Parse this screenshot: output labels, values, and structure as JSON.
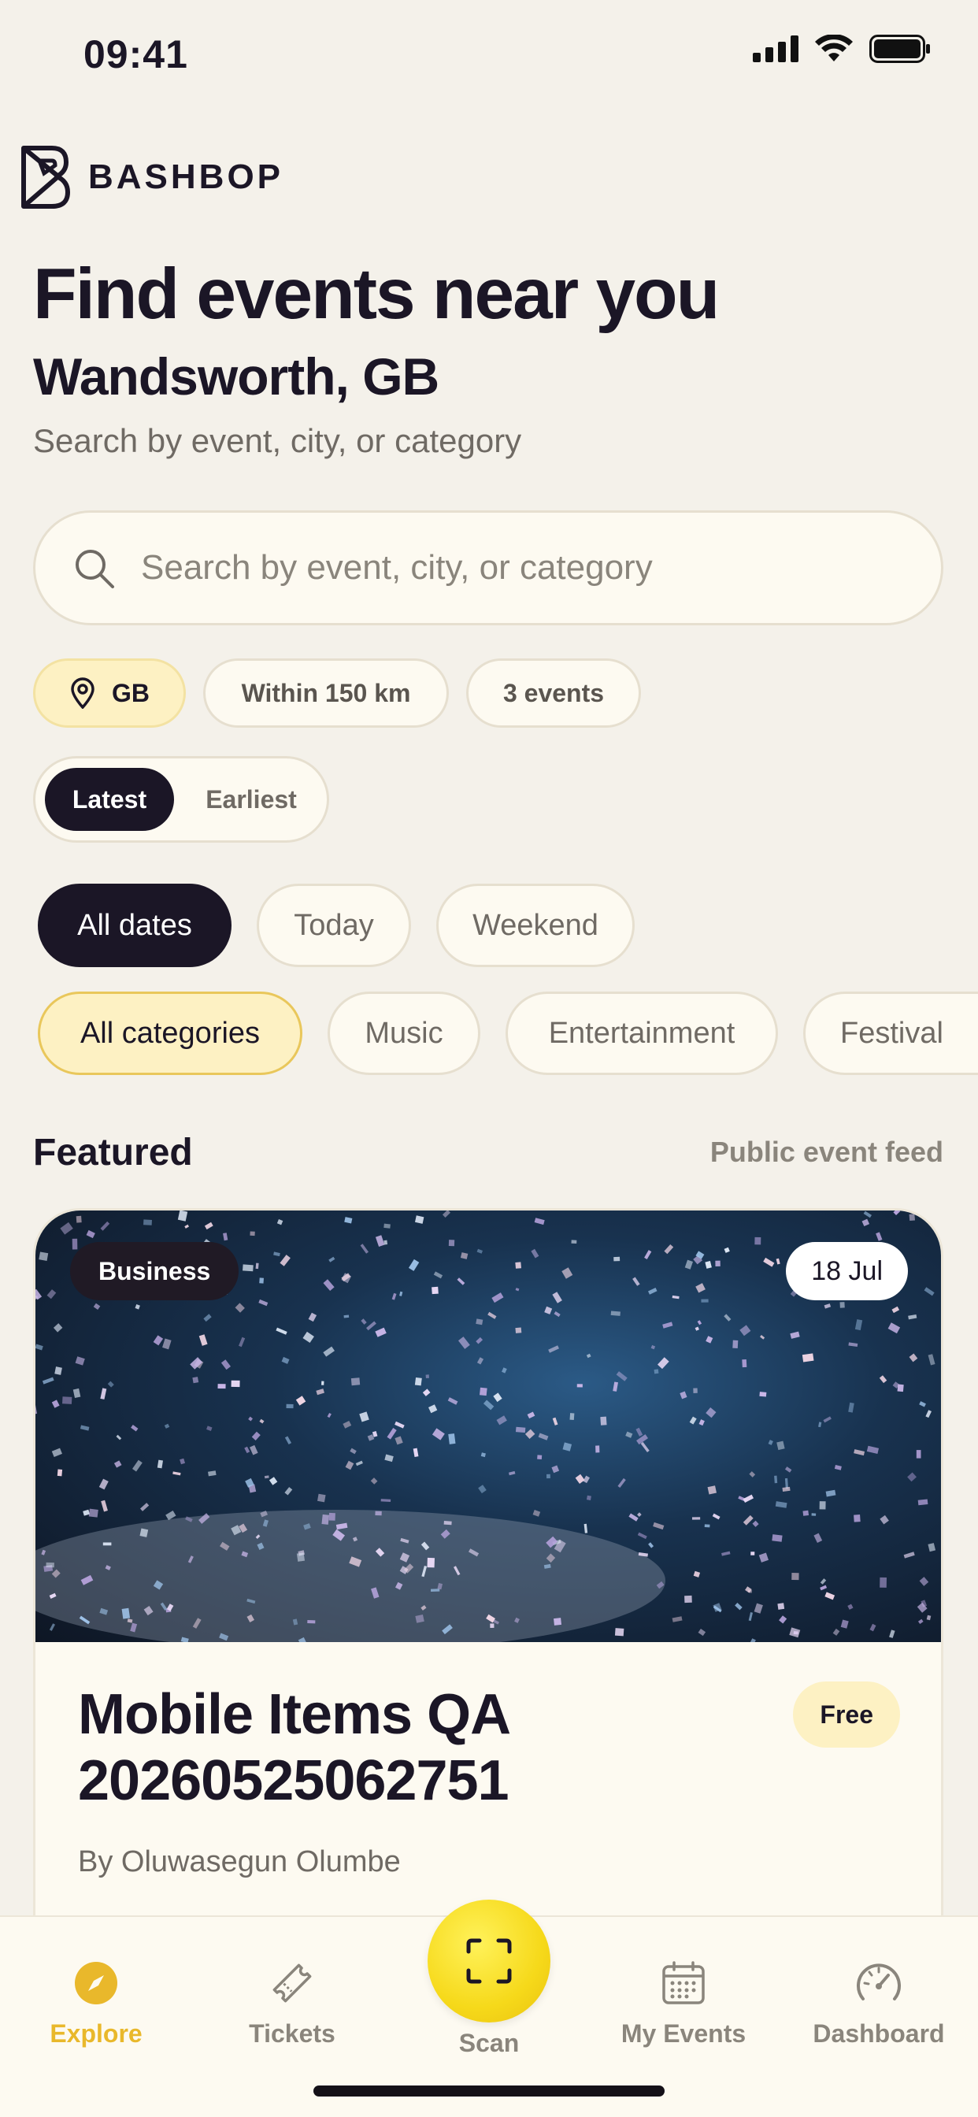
{
  "status": {
    "time": "09:41"
  },
  "brand": {
    "name": "BASHBOP"
  },
  "hero": {
    "title": "Find events near you",
    "location": "Wandsworth, GB",
    "subtitle": "Search by event, city, or category"
  },
  "search": {
    "placeholder": "Search by event, city, or category"
  },
  "filters": {
    "country": "GB",
    "radius": "Within 150 km",
    "count": "3 events"
  },
  "sort": {
    "options": [
      "Latest",
      "Earliest"
    ],
    "selected": "Latest"
  },
  "date_chips": [
    "All dates",
    "Today",
    "Weekend"
  ],
  "category_chips": [
    "All categories",
    "Music",
    "Entertainment",
    "Festival"
  ],
  "featured": {
    "title": "Featured",
    "link": "Public event feed",
    "card": {
      "tag": "Business",
      "date": "18 Jul",
      "title": "Mobile Items QA 20260525062751",
      "price": "Free",
      "organizer": "By Oluwasegun Olumbe"
    }
  },
  "tabs": [
    {
      "label": "Explore",
      "icon": "compass-icon"
    },
    {
      "label": "Tickets",
      "icon": "ticket-icon"
    },
    {
      "label": "Scan",
      "icon": "scan-icon"
    },
    {
      "label": "My Events",
      "icon": "calendar-icon"
    },
    {
      "label": "Dashboard",
      "icon": "gauge-icon"
    }
  ],
  "colors": {
    "accent": "#e9b82b",
    "dark": "#1b1626",
    "background": "#f4f1ea"
  }
}
